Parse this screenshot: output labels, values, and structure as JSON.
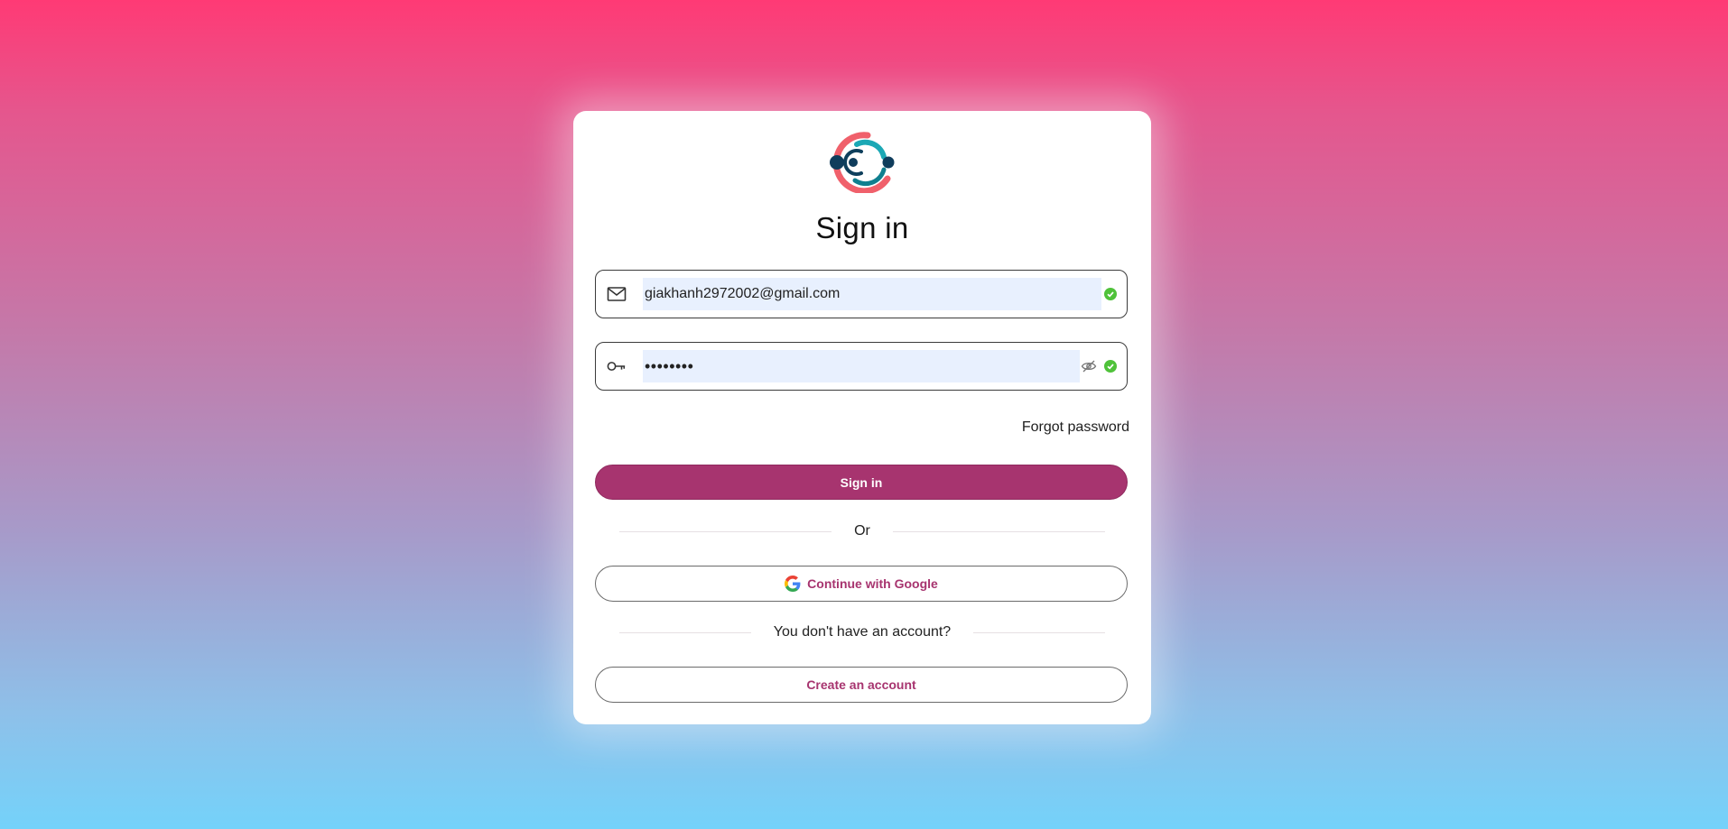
{
  "signin": {
    "title": "Sign in",
    "email": {
      "value": "giakhanh2972002@gmail.com",
      "icon": "mail-icon",
      "status_icon": "check-icon"
    },
    "password": {
      "value": "••••••••",
      "icon": "key-icon",
      "toggle_icon": "eye-off-icon",
      "status_icon": "check-icon"
    },
    "forgot_label": "Forgot password",
    "submit_label": "Sign in",
    "or_label": "Or",
    "google_label": "Continue with Google",
    "no_account_label": "You don't have an account?",
    "create_label": "Create an account"
  },
  "colors": {
    "primary": "#a7346f",
    "success": "#4fc23a",
    "input_fill": "#e8f0fe",
    "gradient_top": "#ff3a75",
    "gradient_bottom": "#74d2fa"
  }
}
